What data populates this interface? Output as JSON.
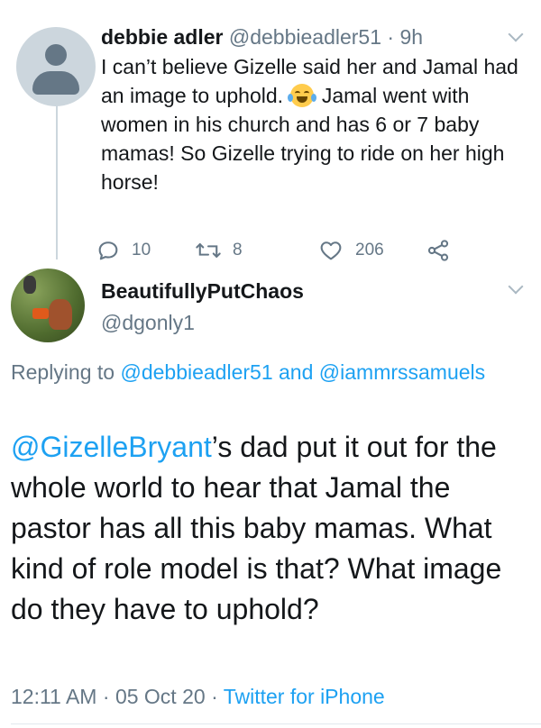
{
  "parent_tweet": {
    "display_name": "debbie adler",
    "handle": "@debbieadler51",
    "separator": "·",
    "time_ago": "9h",
    "text_before_emoji": "I can’t believe Gizelle said her and Jamal had an image to uphold.",
    "emoji": "face-with-tears-of-joy",
    "text_after_emoji": "Jamal went with women in his church and has 6 or 7 baby mamas! So Gizelle trying to ride on her high horse!",
    "replies_count": "10",
    "retweets_count": "8",
    "likes_count": "206"
  },
  "reply_tweet": {
    "display_name": "BeautifullyPutChaos",
    "handle": "@dgonly1",
    "replying_to_prefix": "Replying to",
    "replying_to_user1": "@debbieadler51",
    "replying_to_and": "and",
    "replying_to_user2": "@iammrssamuels",
    "mention": "@GizelleBryant",
    "text": "’s dad put it out for the whole world to hear that Jamal the pastor has all this baby mamas. What kind of role model is that? What image do they have to uphold?",
    "time": "12:11 AM",
    "date": "05 Oct 20",
    "meta_separator": "·",
    "client": "Twitter for iPhone"
  },
  "colors": {
    "accent": "#1da1f2",
    "muted": "#657786",
    "text": "#14171a"
  }
}
